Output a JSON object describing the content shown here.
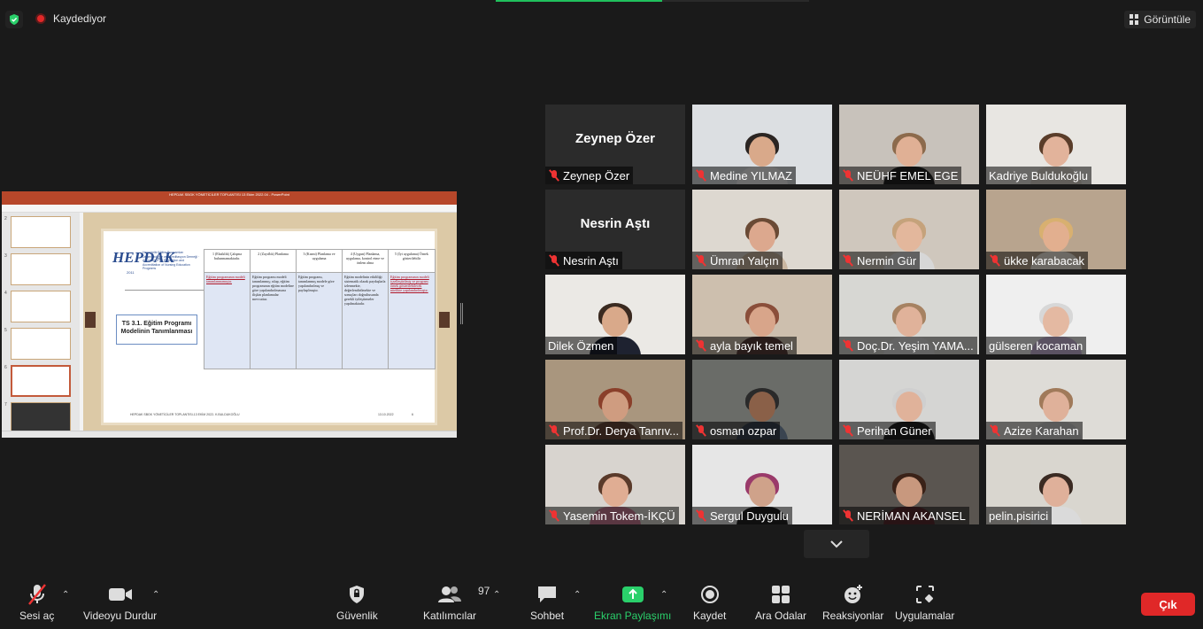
{
  "top": {
    "recording_label": "Kaydediyor",
    "view_label": "Görüntüle",
    "colors": {
      "recording": "#e02828",
      "security_shield": "#2ad06b",
      "share_progress": "#20c05c"
    }
  },
  "shared_screen": {
    "window_title": "HEPDAK SBGK YÖNETİCİLER TOPLANTISI 13 Ekim 2022.04 - PowerPoint",
    "slide": {
      "logo_text": "HEPDAK",
      "logo_subtitle": "Hemşirelik Eğitim Programları Değerlendirme ve Akreditasyon Derneği · Association for Evaluation and Accreditation of Nursing Education Programs",
      "logo_year": "2011",
      "box_title": "TS 3.1. Eğitim Programı Modelinin Tanımlanması",
      "columns": [
        {
          "header": "1 (Eksiklik) Çalışma bulunmamaktadır.",
          "body": "Eğitim programının modeli tanımlanmamıştır.",
          "style": "red"
        },
        {
          "header": "2 (Zayıflık) Planlama",
          "body": "Eğitim programı modeli tanımlanmış; ıslup, eğitim programının eğitim modeline göre yapılandırılmasına ilişkin planlamalar mevcuttur.",
          "style": ""
        },
        {
          "header": "3 (Kısmi) Planlama ve uygulama",
          "body": "Eğitim programı, tanımlanmış modele göre yapılandırılmış ve paylaşılmıştır.",
          "style": ""
        },
        {
          "header": "4 (Uygun) Planlama, uygulama, kontrol etme ve önlem alma",
          "body": "Eğitim modelinin etkililiği sistematik olarak paydaşlarla izlenmekte, değerlendirilmekte ve sonuçları doğrultusunda gerekli iyileştirmeler yapılmaktadır.",
          "style": ""
        },
        {
          "header": "5 (İyi uygulama) Örnek gösterilebilir",
          "body": "Eğitim programının modeli içselleştirilmiş ve program örnek gösterilebilecek nitelikte yapılandırılmıştır.",
          "style": "red"
        }
      ],
      "footer": "HEPDAK SBGK YÖNETİCİLER TOPLANTISI-13 EKİM 2022- K.BULDUKOĞLU",
      "footer_date": "13.10.2022",
      "footer_page": "6"
    }
  },
  "participants": [
    {
      "name": "Zeynep Özer",
      "video": false,
      "big_name": "Zeynep Özer",
      "muted": true
    },
    {
      "name": "Medine YILMAZ",
      "video": true,
      "muted": true,
      "wall": "#dcdfe2",
      "skin": "#d9a98a",
      "hair": "#2b2522",
      "shirt": "#f2f2f2"
    },
    {
      "name": "NEÜHF EMEL EGE",
      "video": true,
      "muted": true,
      "wall": "#c8c2bb",
      "skin": "#e0b095",
      "hair": "#8c6a4c",
      "shirt": "#222"
    },
    {
      "name": "Kadriye Buldukoğlu",
      "video": true,
      "muted": false,
      "active": true,
      "wall": "#e8e6e2",
      "skin": "#e2b39b",
      "hair": "#5a3d2a",
      "shirt": "#d9d3c9"
    },
    {
      "name": "Nesrin Aştı",
      "video": false,
      "big_name": "Nesrin Aştı",
      "muted": true
    },
    {
      "name": "Ümran Yalçın",
      "video": true,
      "muted": true,
      "wall": "#ddd8d0",
      "skin": "#dca88e",
      "hair": "#6a4a35",
      "shirt": "#c9b6a0"
    },
    {
      "name": "Nermin Gür",
      "video": true,
      "muted": true,
      "wall": "#cfc7bd",
      "skin": "#e3b79c",
      "hair": "#c5a27b",
      "shirt": "#d7d7d7"
    },
    {
      "name": "ükke karabacak",
      "video": true,
      "muted": true,
      "wall": "#b8a48e",
      "skin": "#e2af8f",
      "hair": "#d8b070",
      "shirt": "#efe8dd"
    },
    {
      "name": "Dilek Özmen",
      "video": true,
      "muted": false,
      "wall": "#ebe9e5",
      "skin": "#d9a98a",
      "hair": "#3a2a20",
      "shirt": "#1e2230"
    },
    {
      "name": "ayla bayık temel",
      "video": true,
      "muted": true,
      "wall": "#cdbfae",
      "skin": "#d8a58a",
      "hair": "#8a4e3a",
      "shirt": "#5a3f3a"
    },
    {
      "name": "Doç.Dr. Yeşim YAMA...",
      "video": true,
      "muted": true,
      "wall": "#d7d7d3",
      "skin": "#e0b29a",
      "hair": "#a68262",
      "shirt": "#dedede"
    },
    {
      "name": "gülseren kocaman",
      "video": true,
      "muted": false,
      "wall": "#efefef",
      "skin": "#e4b9a2",
      "hair": "#d7d7d7",
      "shirt": "#c9b6d9"
    },
    {
      "name": "Prof.Dr. Derya Tanrıv...",
      "video": true,
      "muted": true,
      "wall": "#a9967e",
      "skin": "#cf9c80",
      "hair": "#8a3f2a",
      "shirt": "#6a4a3a"
    },
    {
      "name": "osman ozpar",
      "video": true,
      "muted": true,
      "wall": "#6a6c68",
      "skin": "#8a6048",
      "hair": "#2a2a2a",
      "shirt": "#3a4450"
    },
    {
      "name": "Perihan Güner",
      "video": true,
      "muted": true,
      "wall": "#d5d5d3",
      "skin": "#e0b29a",
      "hair": "#cfcfcf",
      "shirt": "#222"
    },
    {
      "name": "Azize Karahan",
      "video": true,
      "muted": true,
      "wall": "#dedcd7",
      "skin": "#dfb19a",
      "hair": "#a07a5a",
      "shirt": "#c8c8c8"
    },
    {
      "name": "Yasemin Tokem-İKÇÜ",
      "video": true,
      "muted": true,
      "wall": "#d8d4cf",
      "skin": "#e0ad93",
      "hair": "#5a3a2a",
      "shirt": "#c77a92"
    },
    {
      "name": "Sergul Duygulu",
      "video": true,
      "muted": true,
      "wall": "#e6e6e6",
      "skin": "#cfa28a",
      "hair": "#9a3a6a",
      "shirt": "#222"
    },
    {
      "name": "NERİMAN AKANSEL",
      "video": true,
      "muted": true,
      "wall": "#5a5550",
      "skin": "#c8987e",
      "hair": "#3a2218",
      "shirt": "#5a2a30"
    },
    {
      "name": "pelin.pisirici",
      "video": true,
      "muted": false,
      "wall": "#d9d6cf",
      "skin": "#dfb09a",
      "hair": "#3a2a22",
      "shirt": "#dadada"
    }
  ],
  "toolbar": {
    "mute_label": "Sesi aç",
    "video_label": "Videoyu Durdur",
    "security_label": "Güvenlik",
    "participants_label": "Katılımcılar",
    "participants_count": "97",
    "chat_label": "Sohbet",
    "share_label": "Ekran Paylaşımı",
    "record_label": "Kaydet",
    "breakout_label": "Ara Odalar",
    "reactions_label": "Reaksiyonlar",
    "apps_label": "Uygulamalar",
    "leave_label": "Çık",
    "colors": {
      "share": "#2ad06b",
      "leave": "#e02828"
    }
  }
}
